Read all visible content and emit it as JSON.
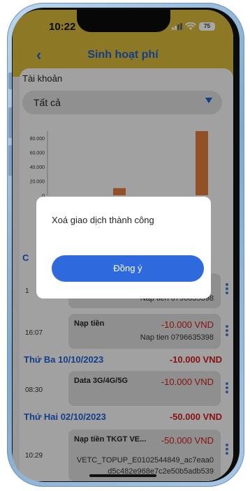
{
  "status_bar": {
    "time": "10:22",
    "battery": "75"
  },
  "header": {
    "title": "Sinh hoạt phí"
  },
  "account": {
    "label": "Tài khoản",
    "selected": "Tất cả"
  },
  "chart_data": {
    "type": "bar",
    "y_ticks": [
      "80.000",
      "60.000",
      "40.000",
      "20.000",
      "0"
    ],
    "ylim": [
      0,
      90000
    ],
    "values": [
      10000,
      90000
    ]
  },
  "dialog": {
    "message": "Xoá giao dịch thành công",
    "ok_label": "Đồng ý"
  },
  "transactions_top": {
    "partial_time": "1",
    "partial_desc": "Nap tien 0796635398",
    "tx": {
      "time": "16:07",
      "type": "Nạp tiền",
      "amount": "-10.000 VND",
      "desc": "Nap tien 0796635398"
    }
  },
  "days": [
    {
      "title": "Thứ Ba 10/10/2023",
      "total": "-10.000 VND",
      "tx": {
        "time": "08:30",
        "type": "Data 3G/4G/5G",
        "amount": "-10.000 VND"
      }
    },
    {
      "title": "Thứ Hai 02/10/2023",
      "total": "-50.000 VND",
      "tx": {
        "time": "10:29",
        "type": "Nạp tiền TKGT VE...",
        "amount": "-50.000 VND",
        "desc_line1": "VETC_TOPUP_E0102544849_ac7eaa0",
        "desc_line2": "d5c482e968e7c2e50b5adb539"
      }
    }
  ]
}
